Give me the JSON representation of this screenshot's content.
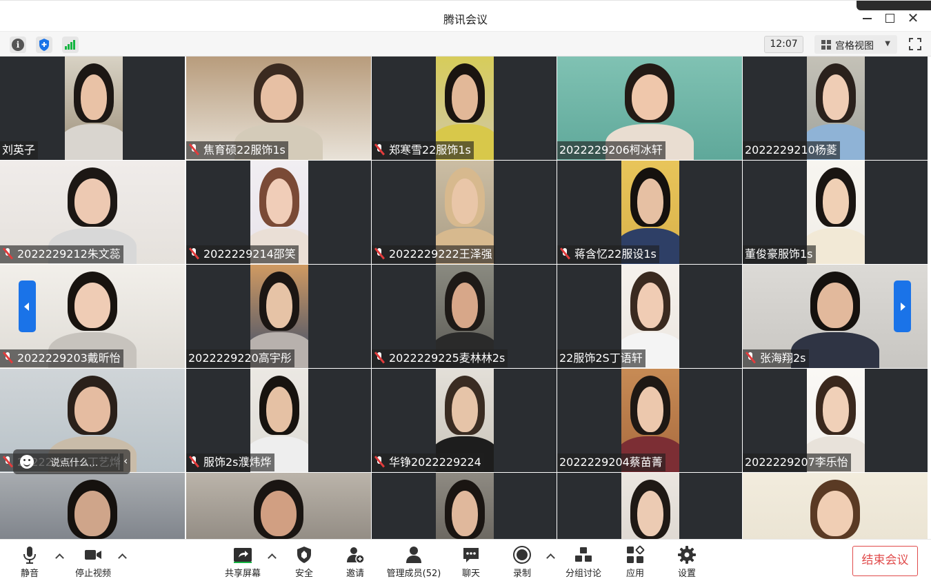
{
  "window": {
    "title": "腾讯会议"
  },
  "infobar": {
    "clock": "12:07",
    "view_label": "宫格视图"
  },
  "participants": [
    {
      "name": "刘英子",
      "muted": false
    },
    {
      "name": "焦育硕22服饰1s",
      "muted": true
    },
    {
      "name": "郑寒雪22服饰1s",
      "muted": true
    },
    {
      "name": "2022229206柯冰轩",
      "muted": false
    },
    {
      "name": "2022229210杨菱",
      "muted": false
    },
    {
      "name": "2022229212朱文蕊",
      "muted": true
    },
    {
      "name": "2022229214邵笑",
      "muted": true
    },
    {
      "name": "2022229222王泽强",
      "muted": true
    },
    {
      "name": "蒋含忆22服设1s",
      "muted": true
    },
    {
      "name": "董俊豪服饰1s",
      "muted": false
    },
    {
      "name": "2022229203戴昕怡",
      "muted": true
    },
    {
      "name": "2022229220高宇彤",
      "muted": false
    },
    {
      "name": "2022229225麦林林2s",
      "muted": true
    },
    {
      "name": "22服饰2S丁语轩",
      "muted": false
    },
    {
      "name": "张海翔2s",
      "muted": true
    },
    {
      "name": "2022229219丁艺烨",
      "muted": true
    },
    {
      "name": "服饰2s濮炜烨",
      "muted": true
    },
    {
      "name": "华铮2022229224",
      "muted": true
    },
    {
      "name": "2022229204蔡苗菁",
      "muted": false
    },
    {
      "name": "2022229207李乐怡",
      "muted": false
    },
    {
      "name": "",
      "muted": false
    },
    {
      "name": "",
      "muted": false
    },
    {
      "name": "",
      "muted": false
    },
    {
      "name": "",
      "muted": false
    },
    {
      "name": "",
      "muted": false
    }
  ],
  "chat_input": {
    "placeholder": "说点什么..."
  },
  "toolbar": {
    "mute": "静音",
    "stop_video": "停止视频",
    "share_screen": "共享屏幕",
    "security": "安全",
    "invite": "邀请",
    "manage_members": "管理成员(52)",
    "chat": "聊天",
    "record": "录制",
    "breakout": "分组讨论",
    "apps": "应用",
    "settings": "设置",
    "end_meeting": "结束会议"
  },
  "colors": {
    "accent": "#1a73e8",
    "end_red": "#e04a4a",
    "signal_green": "#14b541",
    "tile_bg": "#2a2d31"
  }
}
